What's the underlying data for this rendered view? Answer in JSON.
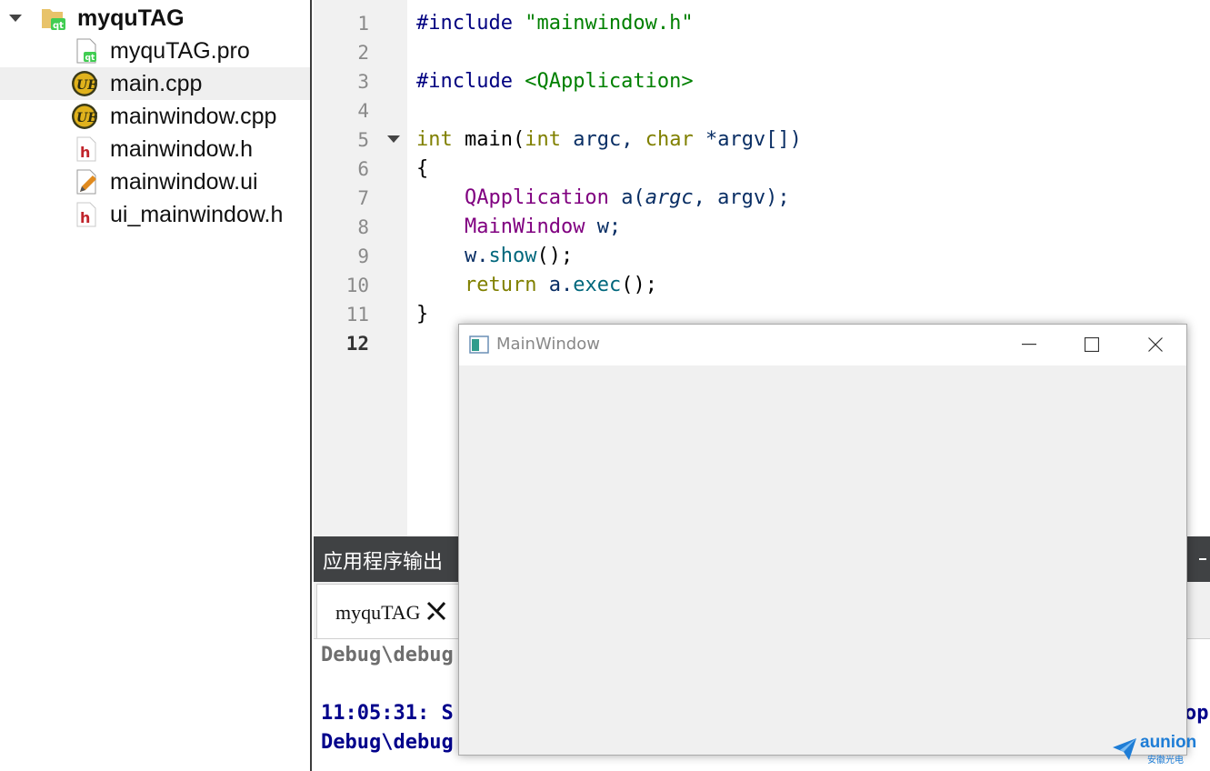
{
  "project_tree": {
    "root": "myquTAG",
    "files": [
      {
        "name": "myquTAG.pro",
        "icon": "qt-project-file-icon",
        "selected": false
      },
      {
        "name": "main.cpp",
        "icon": "cpp-source-file-icon",
        "selected": true
      },
      {
        "name": "mainwindow.cpp",
        "icon": "cpp-source-file-icon",
        "selected": false
      },
      {
        "name": "mainwindow.h",
        "icon": "header-file-icon",
        "selected": false
      },
      {
        "name": "mainwindow.ui",
        "icon": "ui-form-file-icon",
        "selected": false
      },
      {
        "name": "ui_mainwindow.h",
        "icon": "header-file-icon",
        "selected": false
      }
    ]
  },
  "editor": {
    "line_numbers": [
      "1",
      "2",
      "3",
      "4",
      "5",
      "6",
      "7",
      "8",
      "9",
      "10",
      "11",
      "12"
    ],
    "current_line": "12",
    "code": {
      "l1_directive": "#include",
      "l1_string": "\"mainwindow.h\"",
      "l3_directive": "#include",
      "l3_string": "<QApplication>",
      "l5_type1": "int",
      "l5_func": "main(",
      "l5_type2": "int",
      "l5_arg1": "argc, ",
      "l5_type3": "char",
      "l5_arg2": "*argv[])",
      "l6": "{",
      "l7_class": "QApplication",
      "l7_var": "a(",
      "l7_arg1": "argc",
      "l7_rest": ", argv);",
      "l8_class": "MainWindow",
      "l8_var": "w;",
      "l9_obj": "w.",
      "l9_method": "show",
      "l9_rest": "();",
      "l10_kw": "return",
      "l10_obj": "a.",
      "l10_method": "exec",
      "l10_rest": "();",
      "l11": "}"
    }
  },
  "output_pane": {
    "title": "应用程序输出",
    "tab_label": "myquTAG",
    "lines": [
      {
        "text": "Debug\\debug",
        "color": "#6e6e6e"
      },
      {
        "text": "",
        "color": "#000080"
      },
      {
        "text": "11:05:31: S",
        "color": "#00008b"
      },
      {
        "text": "Debug\\debug",
        "color": "#00008b"
      }
    ],
    "right_fragment": "op"
  },
  "main_window": {
    "title": "MainWindow"
  },
  "watermark": {
    "text": "aunion",
    "sub": "安徽光电"
  },
  "colors": {
    "output_header_bg": "#404244",
    "gutter_bg": "#f1f1f1",
    "selection_bg": "#efefef"
  }
}
